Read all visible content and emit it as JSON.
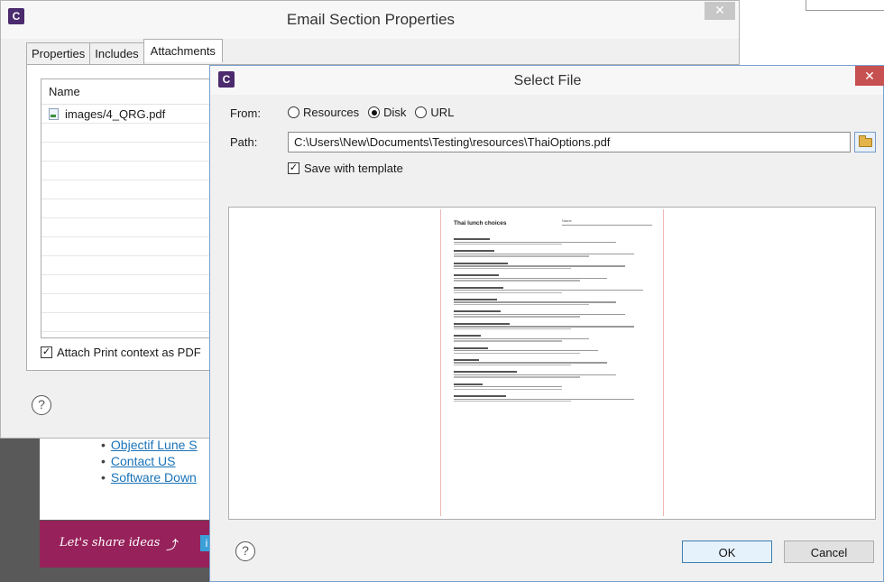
{
  "background_page": {
    "links": [
      "Objectif Lune S",
      "Contact US",
      "Software Down"
    ],
    "banner_text": "Let's share ideas"
  },
  "email_window": {
    "app_icon": "C",
    "title": "Email Section Properties",
    "close_glyph": "✕",
    "tabs": [
      {
        "label": "Properties",
        "active": false
      },
      {
        "label": "Includes",
        "active": false
      },
      {
        "label": "Attachments",
        "active": true
      }
    ],
    "list_header": "Name",
    "attachments": [
      "images/4_QRG.pdf"
    ],
    "attach_print_label": "Attach Print context as PDF",
    "attach_print_checked": true,
    "help_glyph": "?"
  },
  "select_dialog": {
    "app_icon": "C",
    "title": "Select File",
    "close_glyph": "✕",
    "from_label": "From:",
    "sources": [
      {
        "label": "Resources",
        "selected": false
      },
      {
        "label": "Disk",
        "selected": true
      },
      {
        "label": "URL",
        "selected": false
      }
    ],
    "path_label": "Path:",
    "path_value": "C:\\Users\\New\\Documents\\Testing\\resources\\ThaiOptions.pdf",
    "save_with_template_label": "Save with template",
    "save_with_template_checked": true,
    "preview": {
      "title": "Thai lunch choices",
      "name_field": "Name",
      "section_count": 14
    },
    "help_glyph": "?",
    "ok_label": "OK",
    "cancel_label": "Cancel"
  },
  "icons": {
    "app": "app-logo-icon",
    "file": "pdf-file-icon",
    "browse": "folder-open-icon",
    "help": "help-icon",
    "close": "close-icon"
  },
  "colors": {
    "app_icon_bg": "#4b2a6e",
    "dialog_close_bg": "#c75050",
    "link": "#1a73b8",
    "banner_bg": "#97225b"
  }
}
